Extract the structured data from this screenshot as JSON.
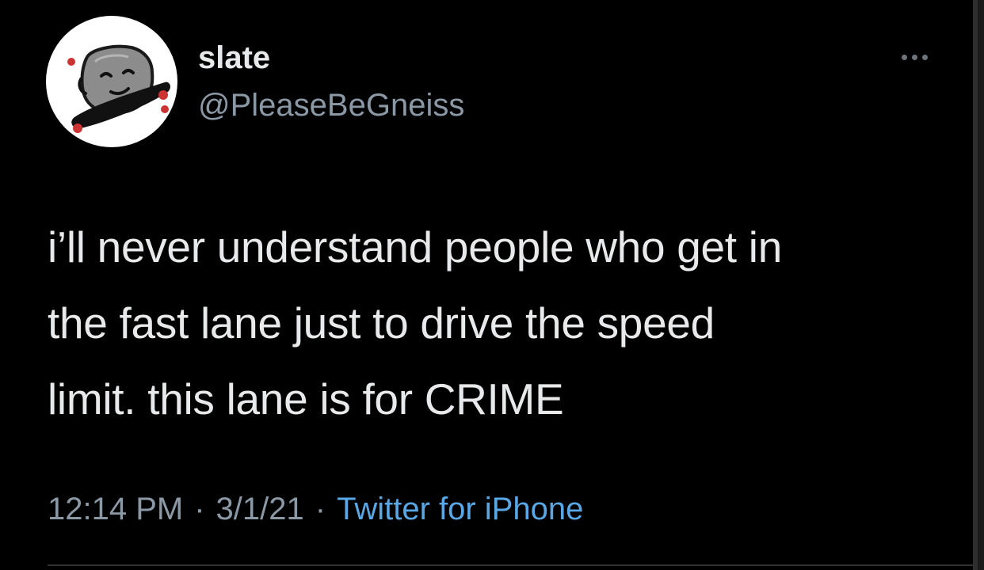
{
  "user": {
    "display_name": "slate",
    "handle": "@PleaseBeGneiss"
  },
  "tweet": {
    "lines": [
      "i’ll never understand people who get in",
      "the fast lane just to drive the speed",
      "limit. this lane is for CRIME"
    ]
  },
  "meta": {
    "time": "12:14 PM",
    "separator": "·",
    "date": "3/1/21",
    "source": "Twitter for iPhone"
  },
  "icons": {
    "more": "more-horizontal-icon",
    "avatar": "rock-on-skateboard-avatar"
  },
  "colors": {
    "background": "#000000",
    "text": "#e7e9ea",
    "secondary_text": "#8b98a5",
    "link": "#5aa7e6"
  }
}
